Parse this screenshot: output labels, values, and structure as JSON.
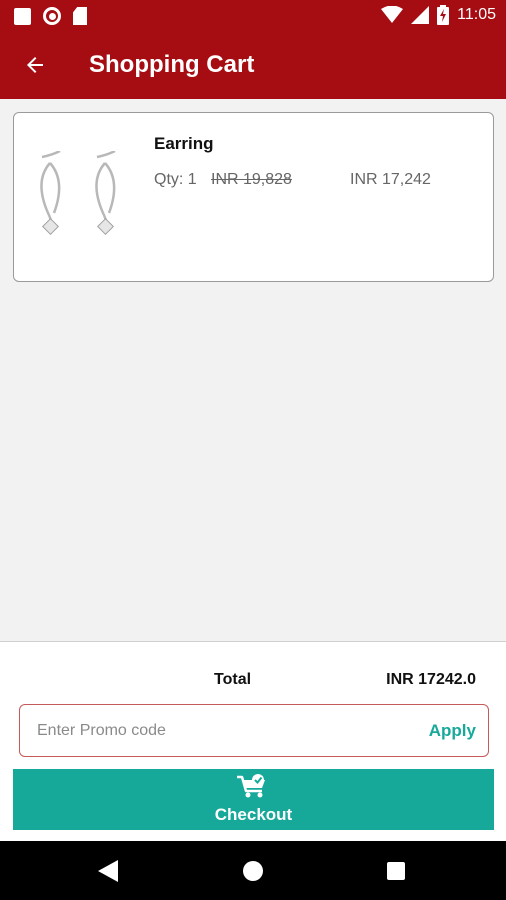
{
  "status_bar": {
    "time": "11:05",
    "icons": [
      "notification-square-icon",
      "record-icon",
      "sd-card-icon",
      "wifi-icon",
      "cell-signal-icon",
      "battery-charging-icon"
    ]
  },
  "app_bar": {
    "title": "Shopping Cart",
    "back_icon": "arrow-left-icon"
  },
  "cart": {
    "items": [
      {
        "name": "Earring",
        "qty": "Qty: 1",
        "original_price": "INR 19,828",
        "price": "INR 17,242",
        "image_icon": "earring-image"
      }
    ]
  },
  "summary": {
    "total_label": "Total",
    "total_value": "INR 17242.0"
  },
  "promo": {
    "placeholder": "Enter Promo code",
    "value": "",
    "apply_label": "Apply"
  },
  "checkout": {
    "label": "Checkout",
    "icon": "cart-check-icon"
  },
  "colors": {
    "primary": "#a50d12",
    "accent": "#16a99a",
    "background": "#f2f2f2"
  }
}
